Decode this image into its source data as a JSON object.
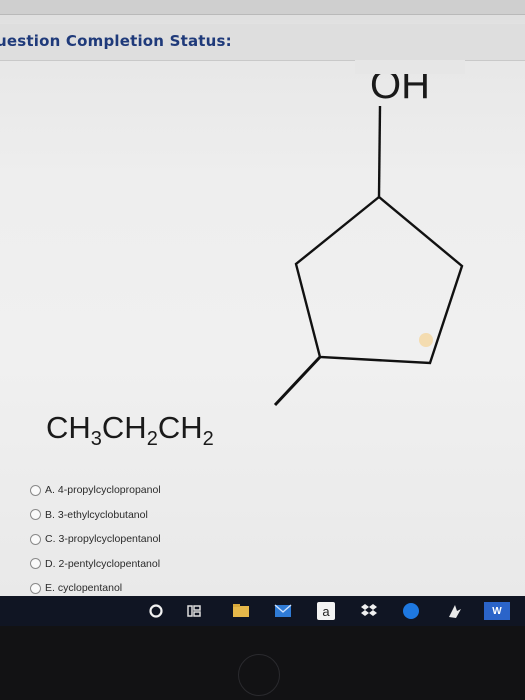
{
  "header": {
    "status_label": "uestion Completion Status:"
  },
  "structure": {
    "oh_label": "OH",
    "substituent": {
      "parts": [
        "CH",
        "3",
        "CH",
        "2",
        "CH",
        "2"
      ]
    }
  },
  "options": [
    {
      "letter": "A.",
      "text": "4-propylcyclopropanol"
    },
    {
      "letter": "B.",
      "text": "3-ethylcyclobutanol"
    },
    {
      "letter": "C.",
      "text": "3-propylcyclopentanol"
    },
    {
      "letter": "D.",
      "text": "2-pentylcyclopentanol"
    },
    {
      "letter": "E.",
      "text": "cyclopentanol"
    }
  ],
  "taskbar": {
    "icons": [
      "cortana-icon",
      "task-view-icon",
      "file-explorer-icon",
      "mail-icon",
      "amazon-icon",
      "dropbox-icon",
      "edge-icon",
      "app-icon",
      "word-icon"
    ],
    "amazon_letter": "a",
    "word_letter": "W"
  },
  "colors": {
    "header_text": "#1f3a7a",
    "taskbar": "#101523"
  }
}
